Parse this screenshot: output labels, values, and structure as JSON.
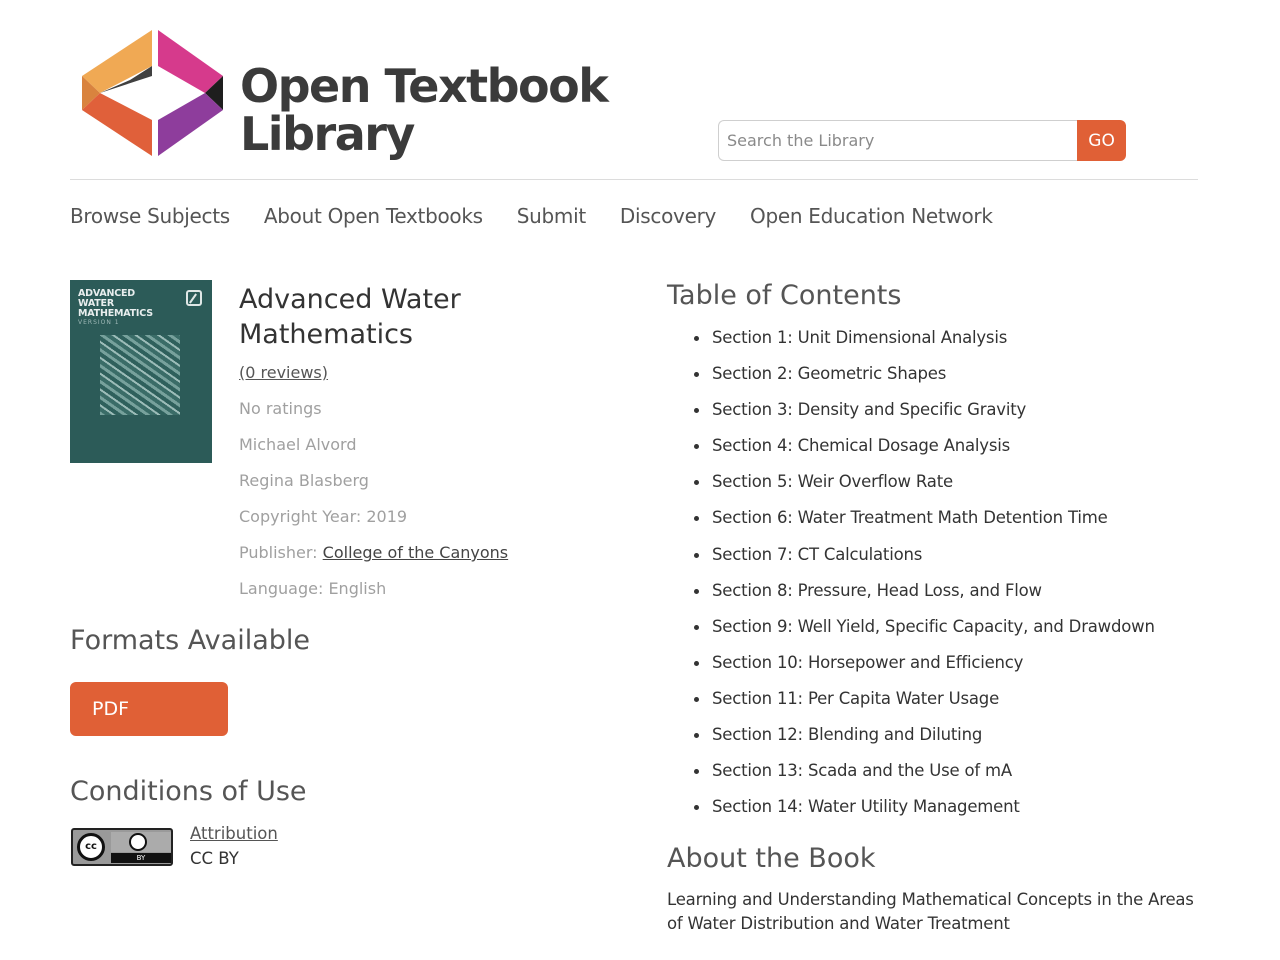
{
  "header": {
    "logo_line1": "Open Textbook",
    "logo_line2": "Library",
    "search_placeholder": "Search the Library",
    "search_value": "",
    "go_label": "GO",
    "colors": {
      "accent": "#e06036",
      "logo_orange": "#f0a954",
      "logo_red": "#e0603a",
      "logo_magenta": "#d63a8c",
      "logo_purple": "#8e3d9c"
    }
  },
  "nav": {
    "items": [
      "Browse Subjects",
      "About Open Textbooks",
      "Submit",
      "Discovery",
      "Open Education Network"
    ]
  },
  "book": {
    "cover": {
      "title_line1": "ADVANCED",
      "title_line2": "WATER",
      "title_line3": "MATHEMATICS",
      "version": "VERSION 1"
    },
    "title": "Advanced Water Mathematics",
    "reviews": "(0 reviews)",
    "ratings": "No ratings",
    "authors": [
      "Michael Alvord",
      "Regina Blasberg"
    ],
    "copyright": "Copyright Year: 2019",
    "publisher_label": "Publisher:",
    "publisher": "College of the Canyons",
    "language": "Language: English"
  },
  "formats": {
    "heading": "Formats Available",
    "pdf_label": "PDF"
  },
  "conditions": {
    "heading": "Conditions of Use",
    "badge_cc": "cc",
    "badge_by": "BY",
    "license_link": "Attribution",
    "license_code": "CC BY"
  },
  "toc": {
    "heading": "Table of Contents",
    "items": [
      "Section 1: Unit Dimensional Analysis",
      "Section 2: Geometric Shapes",
      "Section 3: Density and Specific Gravity",
      "Section 4: Chemical Dosage Analysis",
      "Section 5: Weir Overflow Rate",
      "Section 6: Water Treatment Math Detention Time",
      "Section 7: CT Calculations",
      "Section 8: Pressure, Head Loss, and Flow",
      "Section 9: Well Yield, Specific Capacity, and Drawdown",
      "Section 10: Horsepower and Efficiency",
      "Section 11: Per Capita Water Usage",
      "Section 12: Blending and Diluting",
      "Section 13: Scada and the Use of mA",
      "Section 14: Water Utility Management"
    ]
  },
  "about": {
    "heading": "About the Book",
    "text": "Learning and Understanding Mathematical Concepts in the Areas of Water Distribution and Water Treatment"
  }
}
